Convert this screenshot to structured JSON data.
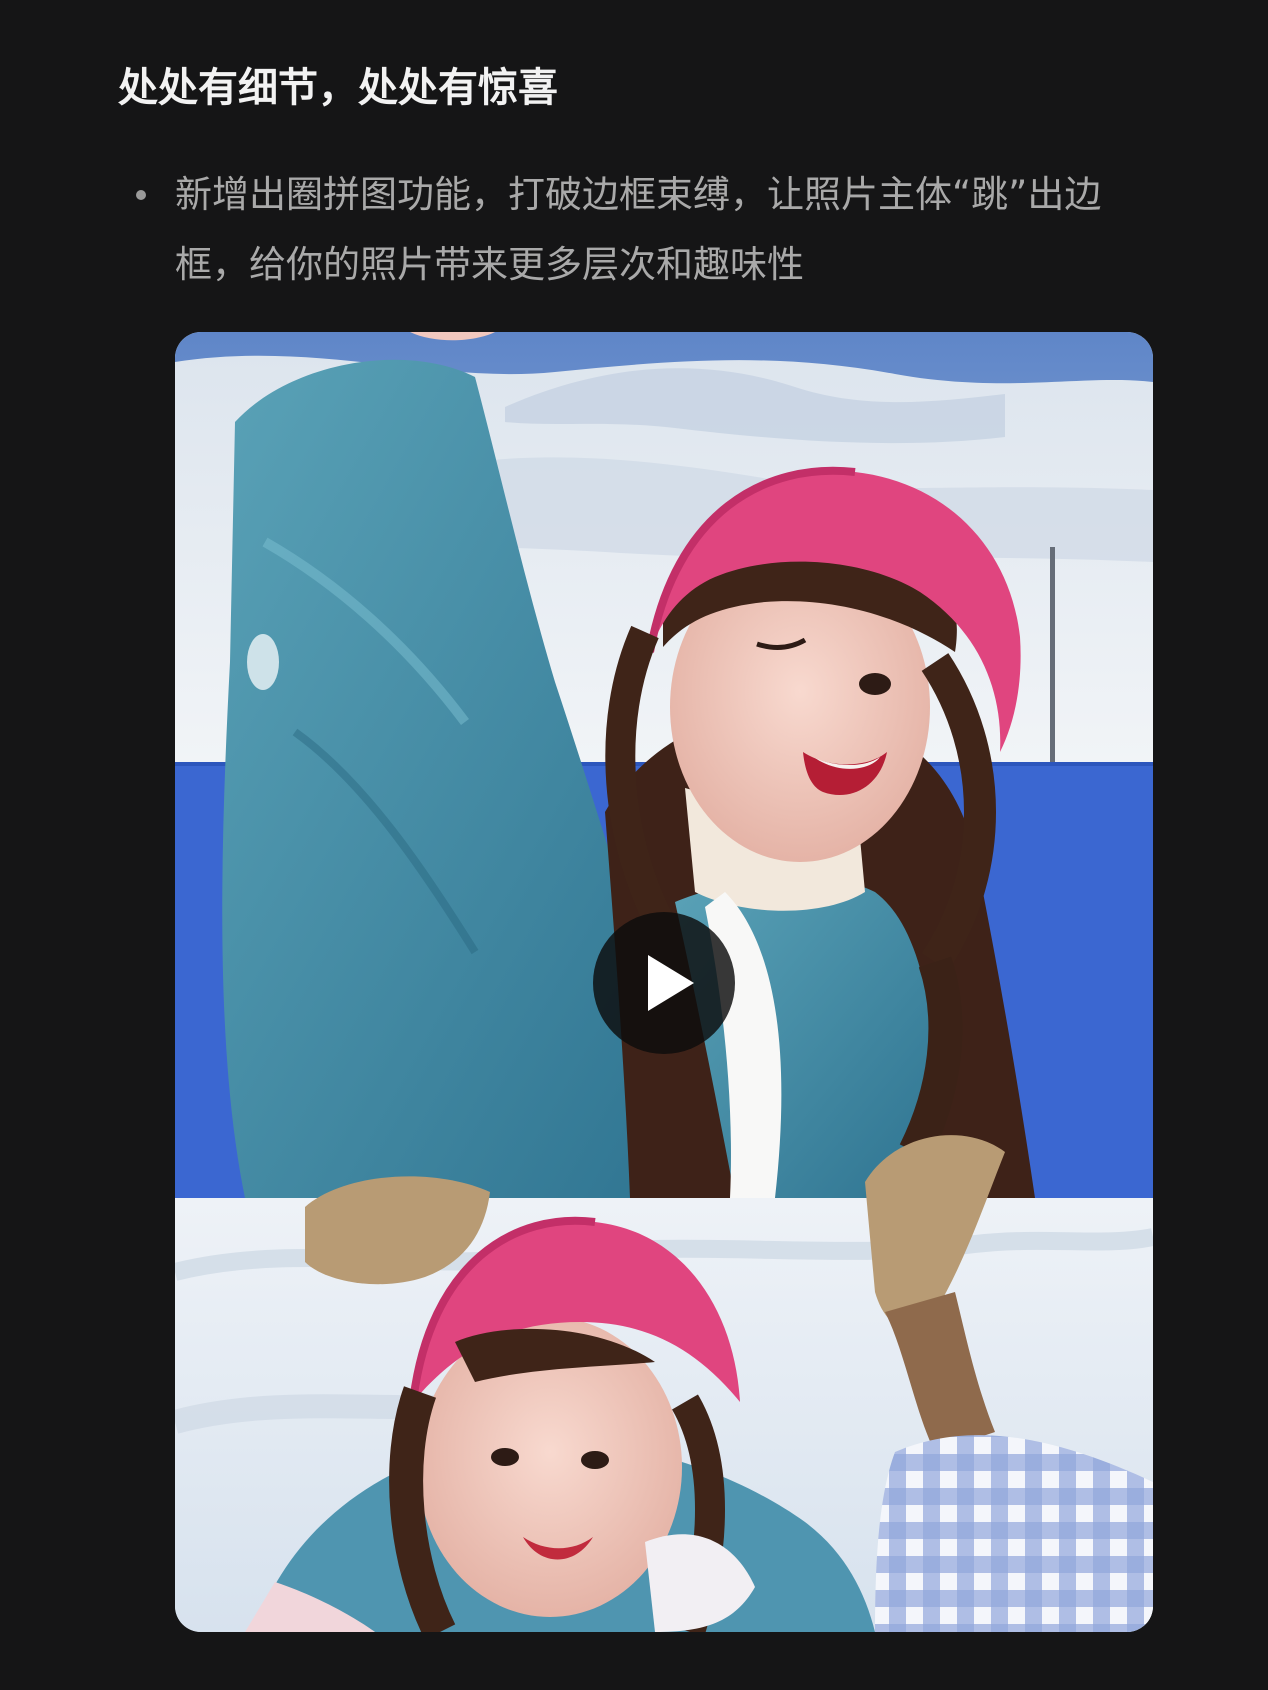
{
  "article": {
    "heading": "处处有细节，处处有惊喜",
    "feature_text": "新增出圈拼图功能，打破边框束缚，让照片主体“跳”出边框，给你的照片带来更多层次和趣味性"
  },
  "media": {
    "play_icon": "play-icon"
  },
  "colors": {
    "background": "#151516",
    "heading": "#f2f2f2",
    "body_text": "#a9a9a9",
    "blue_band": "#3b67d1"
  }
}
